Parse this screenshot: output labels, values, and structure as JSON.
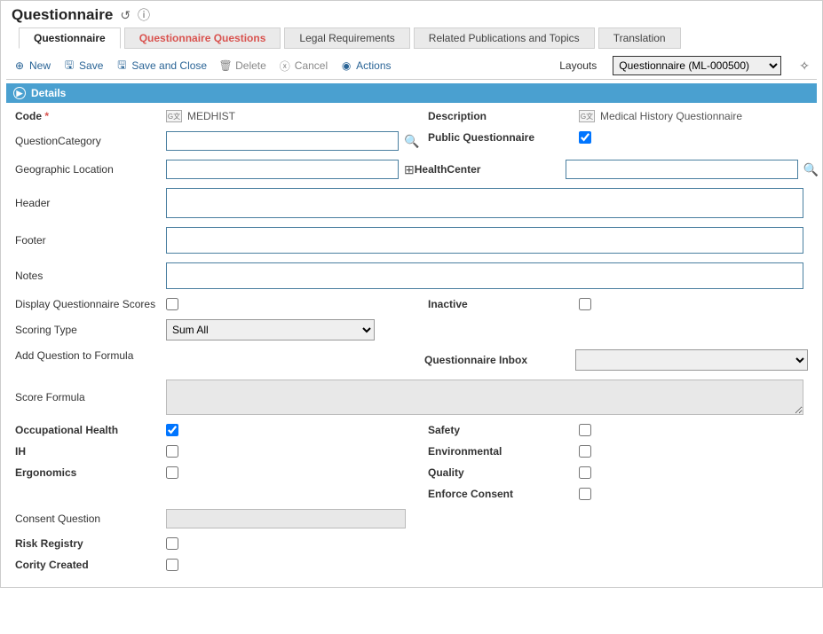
{
  "title": "Questionnaire",
  "tabs": [
    {
      "label": "Questionnaire",
      "active": true,
      "red": false
    },
    {
      "label": "Questionnaire Questions",
      "active": false,
      "red": true
    },
    {
      "label": "Legal Requirements",
      "active": false,
      "red": false
    },
    {
      "label": "Related Publications and Topics",
      "active": false,
      "red": false
    },
    {
      "label": "Translation",
      "active": false,
      "red": false
    }
  ],
  "toolbar": {
    "new": "New",
    "save": "Save",
    "save_close": "Save and Close",
    "delete": "Delete",
    "cancel": "Cancel",
    "actions": "Actions",
    "layouts_label": "Layouts",
    "layouts_value": "Questionnaire (ML-000500)"
  },
  "section": {
    "details": "Details"
  },
  "labels": {
    "code": "Code",
    "description": "Description",
    "question_category": "QuestionCategory",
    "public_questionnaire": "Public Questionnaire",
    "geographic_location": "Geographic Location",
    "health_center": "HealthCenter",
    "header": "Header",
    "footer": "Footer",
    "notes": "Notes",
    "display_scores": "Display Questionnaire Scores",
    "inactive": "Inactive",
    "scoring_type": "Scoring Type",
    "add_formula": "Add Question to Formula",
    "questionnaire_inbox": "Questionnaire Inbox",
    "score_formula": "Score Formula",
    "occ_health": "Occupational Health",
    "safety": "Safety",
    "ih": "IH",
    "environmental": "Environmental",
    "ergonomics": "Ergonomics",
    "quality": "Quality",
    "enforce_consent": "Enforce Consent",
    "consent_question": "Consent Question",
    "risk_registry": "Risk Registry",
    "cority_created": "Cority Created"
  },
  "values": {
    "code": "MEDHIST",
    "description": "Medical History Questionnaire",
    "question_category": "",
    "geographic_location": "",
    "health_center": "",
    "header": "",
    "footer": "",
    "notes": "",
    "scoring_type": "Sum All",
    "questionnaire_inbox": "",
    "score_formula": "",
    "consent_question": ""
  },
  "checks": {
    "public_questionnaire": true,
    "display_scores": false,
    "inactive": false,
    "occ_health": true,
    "safety": false,
    "ih": false,
    "environmental": false,
    "ergonomics": false,
    "quality": false,
    "enforce_consent": false,
    "risk_registry": false,
    "cority_created": false
  }
}
